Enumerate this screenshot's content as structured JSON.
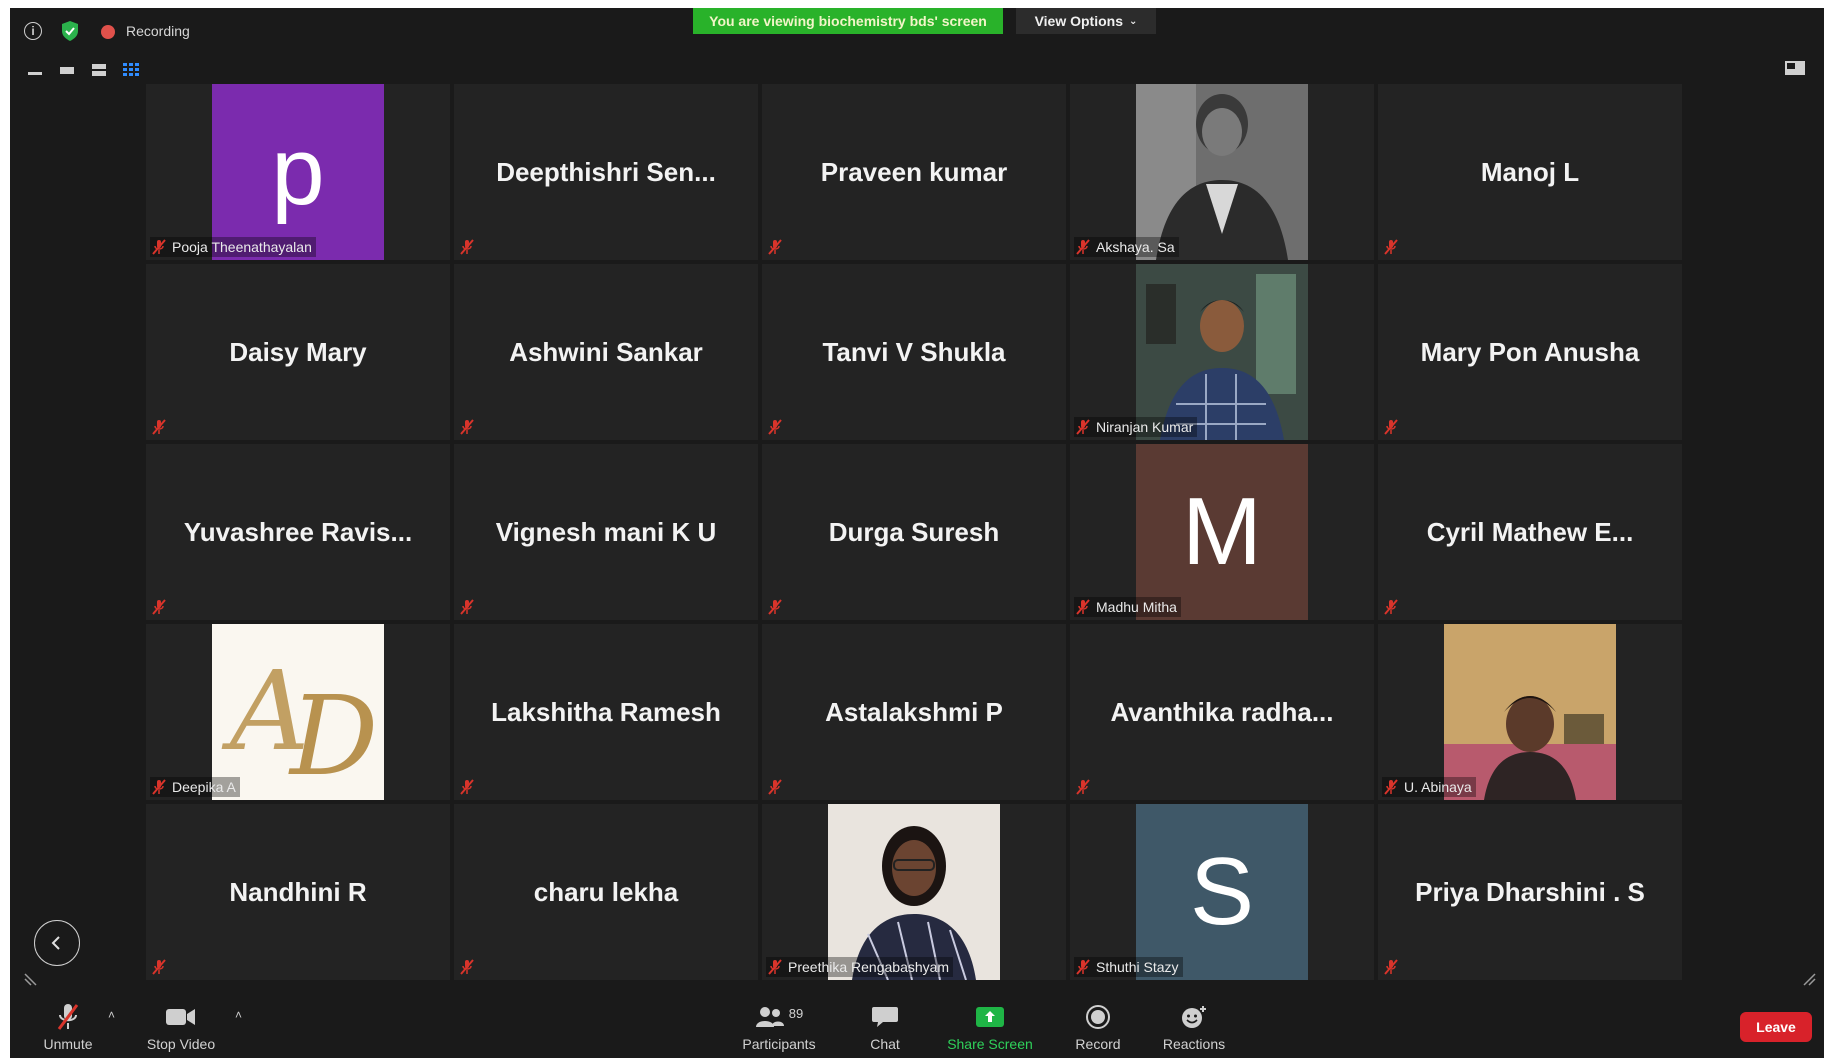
{
  "topbar": {
    "recording_label": "Recording",
    "viewing_banner": "You are viewing biochemistry bds' screen",
    "view_options_label": "View Options"
  },
  "tiles": [
    {
      "name": "Pooja Theenathayalan",
      "big": "",
      "avatar_letter": "p",
      "avatar_color": "#7b2bae"
    },
    {
      "name": "",
      "big": "Deepthishri  Sen..."
    },
    {
      "name": "",
      "big": "Praveen kumar"
    },
    {
      "name": "Akshaya. Sa",
      "big": "",
      "photo": "akshaya-photo"
    },
    {
      "name": "",
      "big": "Manoj L"
    },
    {
      "name": "",
      "big": "Daisy Mary"
    },
    {
      "name": "",
      "big": "Ashwini Sankar"
    },
    {
      "name": "",
      "big": "Tanvi V Shukla"
    },
    {
      "name": "Niranjan Kumar",
      "big": "",
      "photo": "niranjan-photo"
    },
    {
      "name": "",
      "big": "Mary Pon Anusha"
    },
    {
      "name": "",
      "big": "Yuvashree  Ravis..."
    },
    {
      "name": "",
      "big": "Vignesh mani K U"
    },
    {
      "name": "",
      "big": "Durga Suresh"
    },
    {
      "name": "Madhu Mitha",
      "big": "",
      "avatar_letter": "M",
      "avatar_color": "#5a3a33"
    },
    {
      "name": "",
      "big": "Cyril  Mathew  E..."
    },
    {
      "name": "Deepika A",
      "big": "",
      "photo": "ad-logo"
    },
    {
      "name": "",
      "big": "Lakshitha Ramesh"
    },
    {
      "name": "",
      "big": "Astalakshmi P"
    },
    {
      "name": "",
      "big": "Avanthika  radha..."
    },
    {
      "name": "U. Abinaya",
      "big": "",
      "photo": "abinaya-photo"
    },
    {
      "name": "",
      "big": "Nandhini R"
    },
    {
      "name": "",
      "big": "charu lekha"
    },
    {
      "name": "Preethika Rengabashyam",
      "big": "",
      "photo": "preethika-photo"
    },
    {
      "name": "Sthuthi Stazy",
      "big": "",
      "avatar_letter": "S",
      "avatar_color": "#3f5868"
    },
    {
      "name": "",
      "big": "Priya Dharshini . S"
    }
  ],
  "toolbar": {
    "unmute_label": "Unmute",
    "stop_video_label": "Stop Video",
    "participants_label": "Participants",
    "participants_count": "89",
    "chat_label": "Chat",
    "share_screen_label": "Share Screen",
    "record_label": "Record",
    "reactions_label": "Reactions",
    "leave_label": "Leave"
  },
  "colors": {
    "banner_green": "#29b22a",
    "mute_red": "#d9342b",
    "leave_red": "#d8222a",
    "share_green": "#1fb546",
    "tile_bg": "#232323",
    "app_bg": "#1a1a1a"
  }
}
